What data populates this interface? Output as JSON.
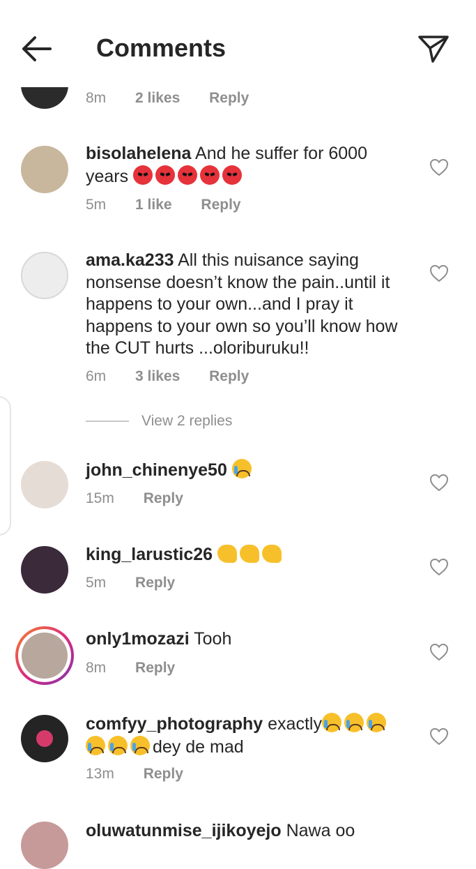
{
  "header": {
    "title": "Comments",
    "back_icon": "arrow-left-icon",
    "send_icon": "paper-plane-icon"
  },
  "comments": [
    {
      "time": "8m",
      "likes": "2 likes",
      "reply": "Reply"
    },
    {
      "username": "bisolahelena",
      "text": "And he suffer for 6000 years",
      "emoji": "angry-face x5",
      "time": "5m",
      "likes": "1 like",
      "reply": "Reply"
    },
    {
      "username": "ama.ka233",
      "text": "All this nuisance saying nonsense doesn’t know the pain..until it happens to your own...and I pray it happens to your own so you’ll know how the CUT hurts ...oloriburuku!!",
      "time": "6m",
      "likes": "3 likes",
      "reply": "Reply"
    },
    {
      "username": "john_chinenye50",
      "emoji": "crying-face",
      "time": "15m",
      "reply": "Reply"
    },
    {
      "username": "king_larustic26",
      "emoji": "flexed-biceps x3",
      "time": "5m",
      "reply": "Reply"
    },
    {
      "username": "only1mozazi",
      "text": "Tooh",
      "time": "8m",
      "reply": "Reply"
    },
    {
      "username": "comfyy_photography",
      "text": "exactly",
      "text_after": "dey de mad",
      "emoji": "crying-face x6",
      "time": "13m",
      "reply": "Reply"
    },
    {
      "username": "oluwatunmise_ijikoyejo",
      "text": "Nawa oo"
    }
  ],
  "view_replies": "View 2 replies",
  "colors": {
    "text": "#262626",
    "secondary": "#8e8e8e",
    "story_ring": "#e1306c"
  }
}
